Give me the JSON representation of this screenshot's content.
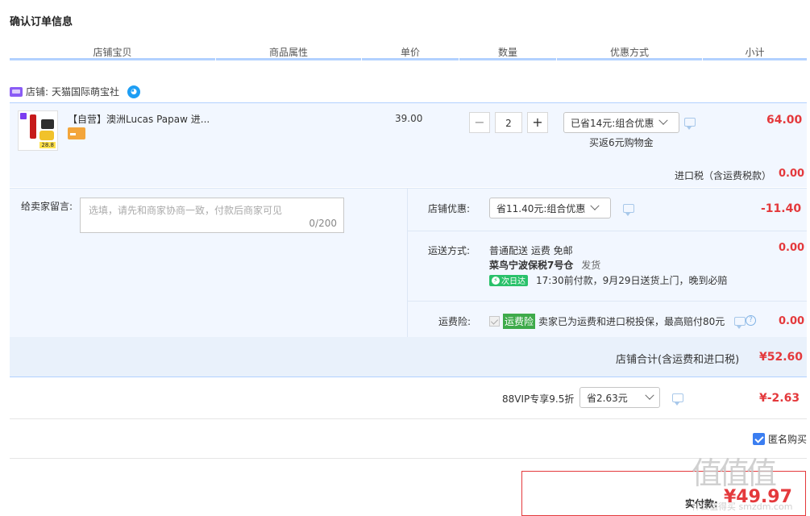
{
  "page_title": "确认订单信息",
  "columns": [
    "店铺宝贝",
    "商品属性",
    "单价",
    "数量",
    "优惠方式",
    "小计"
  ],
  "shop": {
    "label": "店铺:",
    "name": "天猫国际萌宝社"
  },
  "item": {
    "title": "【自营】澳洲Lucas Papaw 进...",
    "thumb_price": "28.8",
    "unit_price": "39.00",
    "quantity": "2",
    "qty_minus": "−",
    "qty_plus": "+",
    "discount_select": "已省14元:组合优惠",
    "rebate": "买返6元购物金",
    "subtotal": "64.00",
    "import_tax_label": "进口税（含运费税款）",
    "import_tax_value": "0.00"
  },
  "note": {
    "label": "给卖家留言:",
    "placeholder": "选填，请先和商家协商一致，付款后商家可见",
    "count": "0/200"
  },
  "shop_discount": {
    "label": "店铺优惠:",
    "select": "省11.40元:组合优惠",
    "value": "-11.40"
  },
  "shipping": {
    "label": "运送方式:",
    "method": "普通配送 运费 免邮",
    "warehouse": "菜鸟宁波保税7号仓",
    "ship_word": "发货",
    "next_day_tag": "次日达",
    "promise": "17:30前付款，9月29日送货上门，晚到必赔",
    "value": "0.00"
  },
  "insurance": {
    "label": "运费险:",
    "tag": "运费险",
    "desc": "卖家已为运费和进口税投保，最高赔付80元",
    "value": "0.00"
  },
  "shop_total": {
    "label": "店铺合计(含运费和进口税)",
    "value": "¥52.60"
  },
  "vip": {
    "label": "88VIP专享9.5折",
    "select": "省2.63元",
    "value": "¥-2.63"
  },
  "anonymous": {
    "label": "匿名购买"
  },
  "pay": {
    "label": "实付款:",
    "amount": "¥49.97"
  },
  "watermark": {
    "text": "值值值",
    "site": "什么值得买 smzdm.com"
  }
}
